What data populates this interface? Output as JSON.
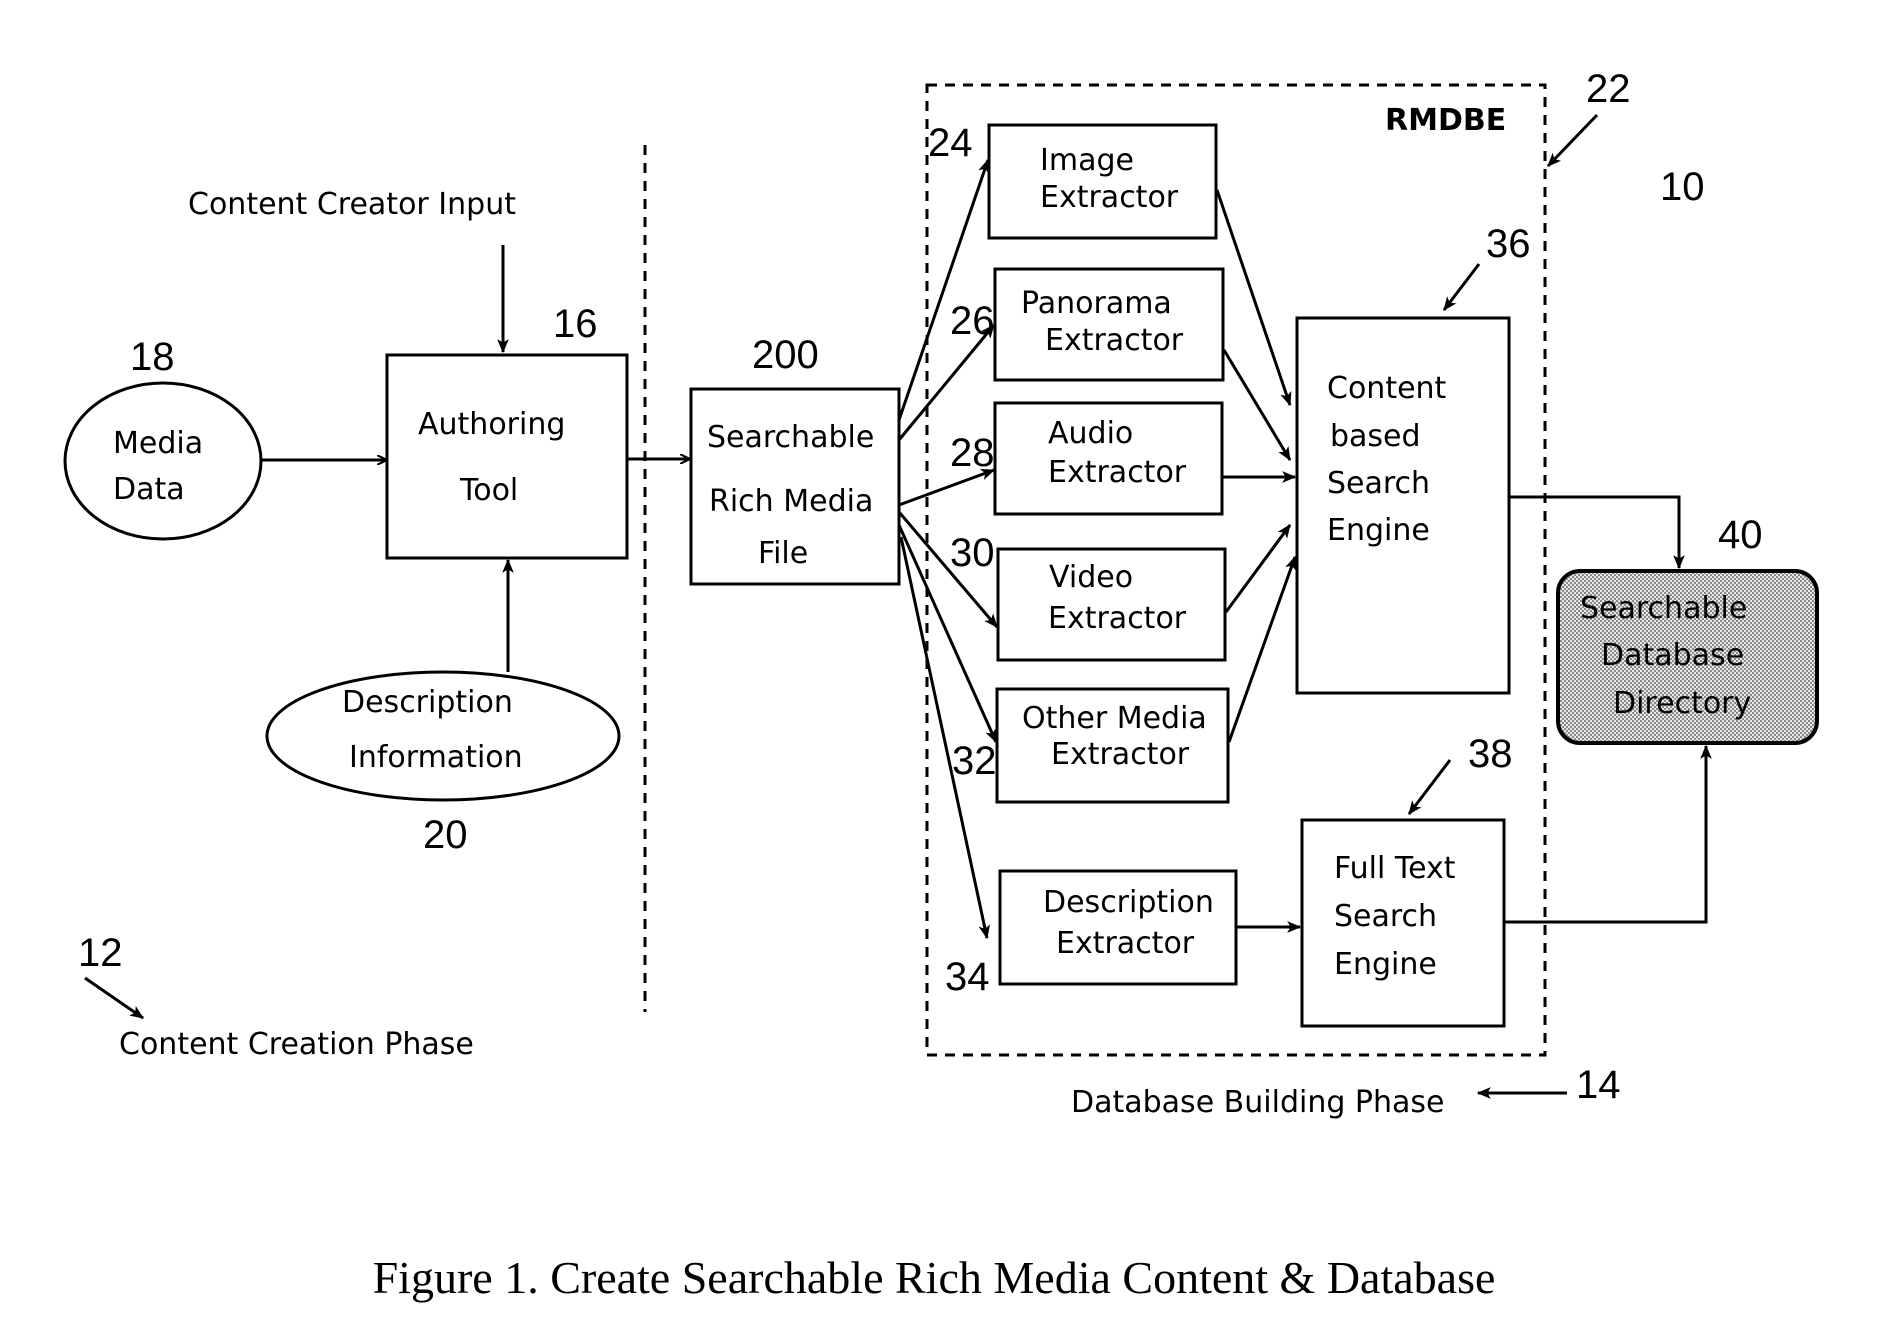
{
  "figure": {
    "caption": "Figure 1. Create Searchable Rich Media Content & Database",
    "system_ref": "10",
    "colors": {
      "ink": "#000000",
      "background": "#ffffff",
      "database_fill": "#bdbdbd"
    }
  },
  "content_creation_phase": {
    "label": "Content Creation Phase",
    "ref": "12",
    "content_creator_input": "Content Creator Input",
    "media_data": {
      "lines": [
        "Media",
        "Data"
      ],
      "ref": "18"
    },
    "authoring_tool": {
      "lines": [
        "Authoring",
        "Tool"
      ],
      "ref": "16"
    },
    "description_information": {
      "lines": [
        "Description",
        "Information"
      ],
      "ref": "20"
    }
  },
  "searchable_rich_media_file": {
    "lines": [
      "Searchable",
      "Rich Media",
      "File"
    ],
    "ref": "200"
  },
  "database_building_phase": {
    "label": "Database Building Phase",
    "ref": "14",
    "rmdbe": {
      "label": "RMDBE",
      "ref": "22"
    },
    "extractors": [
      {
        "lines": [
          "Image",
          "Extractor"
        ],
        "ref": "24"
      },
      {
        "lines": [
          "Panorama",
          "Extractor"
        ],
        "ref": "26"
      },
      {
        "lines": [
          "Audio",
          "Extractor"
        ],
        "ref": "28"
      },
      {
        "lines": [
          "Video",
          "Extractor"
        ],
        "ref": "30"
      },
      {
        "lines": [
          "Other Media",
          "Extractor"
        ],
        "ref": "32"
      },
      {
        "lines": [
          "Description",
          "Extractor"
        ],
        "ref": "34"
      }
    ],
    "content_search_engine": {
      "lines": [
        "Content",
        "based",
        "Search",
        "Engine"
      ],
      "ref": "36"
    },
    "full_text_search_engine": {
      "lines": [
        "Full Text",
        "Search",
        "Engine"
      ],
      "ref": "38"
    },
    "database_directory": {
      "lines": [
        "Searchable",
        "Database",
        "Directory"
      ],
      "ref": "40"
    }
  }
}
